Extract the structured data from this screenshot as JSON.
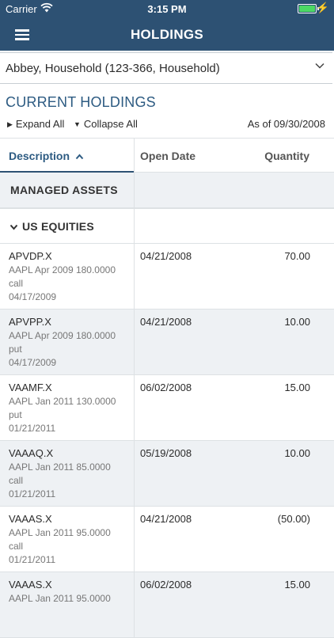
{
  "status_bar": {
    "carrier": "Carrier",
    "time": "3:15 PM",
    "battery_level": 1.0,
    "icons": [
      "wifi-icon",
      "battery-icon",
      "charging-bolt-icon"
    ]
  },
  "nav": {
    "title": "HOLDINGS",
    "menu_icon": "hamburger-menu-icon"
  },
  "account_selector": {
    "value": "Abbey, Household (123-366, Household)"
  },
  "holdings": {
    "section_title": "CURRENT HOLDINGS",
    "expand_all": "Expand All",
    "collapse_all": "Collapse All",
    "as_of": "As of 09/30/2008"
  },
  "table": {
    "columns": {
      "description": "Description",
      "open_date": "Open Date",
      "quantity": "Quantity"
    },
    "sort": {
      "column": "description",
      "direction": "ascending"
    },
    "group": "MANAGED ASSETS",
    "subgroup": "US EQUITIES",
    "rows": [
      {
        "symbol": "APVDP.X",
        "line1": "AAPL Apr 2009 180.0000",
        "line2": "call",
        "line3": "04/17/2009",
        "open_date": "04/21/2008",
        "quantity": "70.00"
      },
      {
        "symbol": "APVPP.X",
        "line1": "AAPL Apr 2009 180.0000",
        "line2": "put",
        "line3": "04/17/2009",
        "open_date": "04/21/2008",
        "quantity": "10.00"
      },
      {
        "symbol": "VAAMF.X",
        "line1": "AAPL Jan 2011 130.0000",
        "line2": "put",
        "line3": "01/21/2011",
        "open_date": "06/02/2008",
        "quantity": "15.00"
      },
      {
        "symbol": "VAAAQ.X",
        "line1": "AAPL Jan 2011 85.0000",
        "line2": "call",
        "line3": "01/21/2011",
        "open_date": "05/19/2008",
        "quantity": "10.00"
      },
      {
        "symbol": "VAAAS.X",
        "line1": "AAPL Jan 2011 95.0000",
        "line2": "call",
        "line3": "01/21/2011",
        "open_date": "04/21/2008",
        "quantity": "(50.00)"
      },
      {
        "symbol": "VAAAS.X",
        "line1": "AAPL Jan 2011 95.0000",
        "line2": "",
        "line3": "",
        "open_date": "06/02/2008",
        "quantity": "15.00"
      }
    ]
  },
  "colors": {
    "header": "#2d5173",
    "accent_text": "#2d5b82",
    "alt_row": "#eef1f4"
  }
}
